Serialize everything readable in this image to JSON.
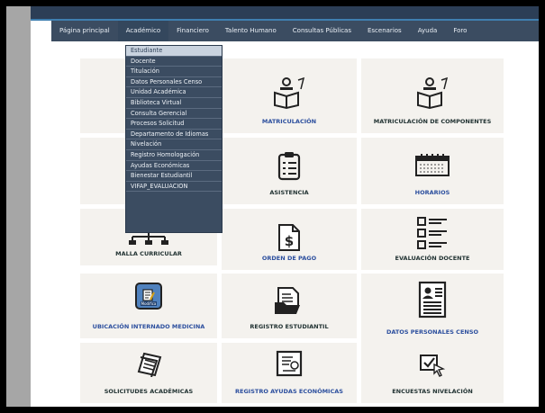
{
  "nav": {
    "items": [
      "Página principal",
      "Académico",
      "Financiero",
      "Talento Humano",
      "Consultas Públicas",
      "Escenarios",
      "Ayuda",
      "Foro"
    ]
  },
  "dropdown": {
    "items": [
      "Estudiante",
      "Docente",
      "Titulación",
      "Datos Personales Censo",
      "Unidad Académica",
      "Biblioteca Virtual",
      "Consulta Gerencial",
      "Procesos Solicitud",
      "Departamento de Idiomas",
      "Nivelación",
      "Registro Homologación",
      "Ayudas Económicas",
      "Bienestar Estudiantil",
      "VIFAP_EVALUACION"
    ]
  },
  "tiles": {
    "matriculacion": "MATRICULACIÓN",
    "matriculacion_componentes": "MATRICULACIÓN DE COMPONENTES",
    "asistencia": "ASISTENCIA",
    "horarios": "HORARIOS",
    "malla_curricular": "MALLA CURRICULAR",
    "orden_pago": "ORDEN DE PAGO",
    "evaluacion_docente": "EVALUACIÓN DOCENTE",
    "ubicacion_internado": "UBICACIÓN INTERNADO MEDICINA",
    "registro_estudiantil": "REGISTRO ESTUDIANTIL",
    "datos_personales": "DATOS PERSONALES CENSO",
    "solicitudes": "SOLICITUDES ACADÉMICAS",
    "registro_ayudas": "REGISTRO AYUDAS ECONÓMICAS",
    "encuestas": "ENCUESTAS NIVELACIÓN"
  },
  "icons": {
    "modifica_text": "Modifica"
  },
  "colors": {
    "navbar": "#3b4c61",
    "label_blue": "#2c4f9e",
    "tile_bg": "#f4f2ee"
  }
}
